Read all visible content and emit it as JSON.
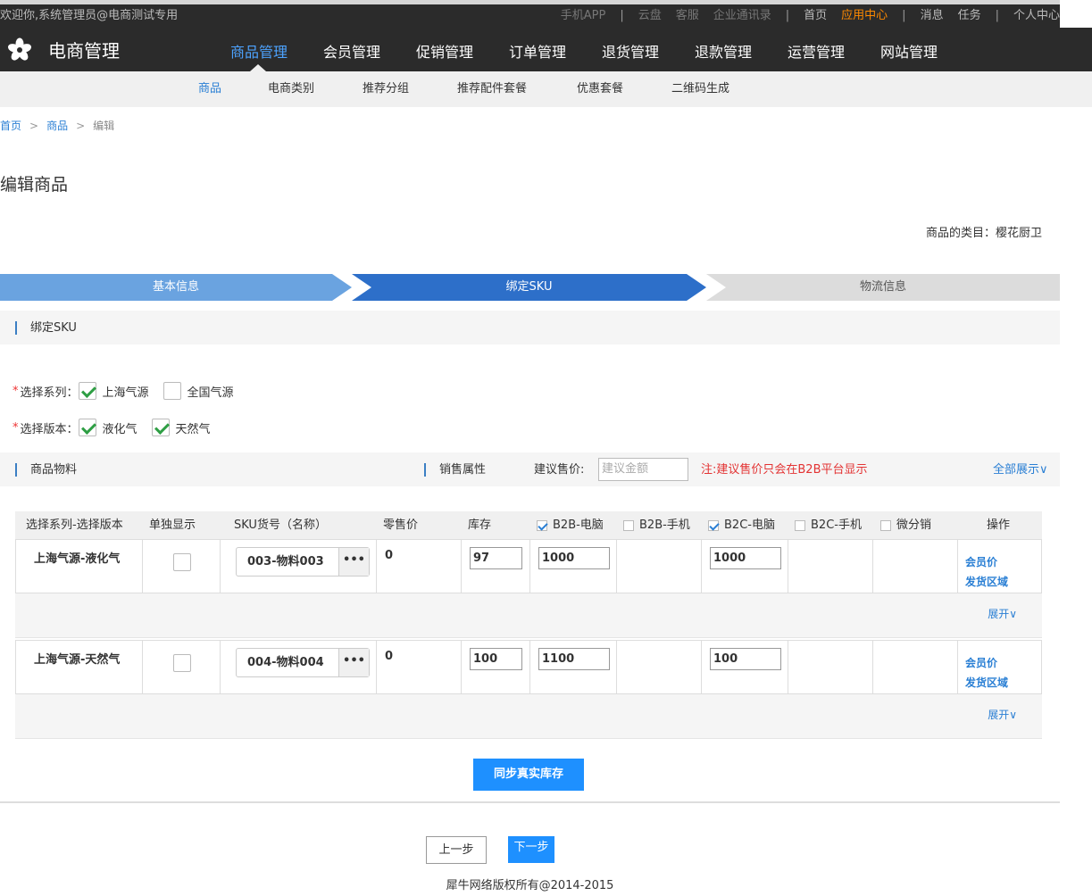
{
  "topbar": {
    "welcome": "欢迎你,系统管理员@电商测试专用",
    "links": {
      "app": "手机APP",
      "cloud": "云盘",
      "service": "客服",
      "contacts": "企业通讯录",
      "home": "首页",
      "appcenter": "应用中心",
      "messages": "消息",
      "tasks": "任务",
      "profile": "个人中心"
    }
  },
  "brand": {
    "title": "电商管理"
  },
  "mainnav": [
    {
      "label": "商品管理",
      "active": true
    },
    {
      "label": "会员管理"
    },
    {
      "label": "促销管理"
    },
    {
      "label": "订单管理"
    },
    {
      "label": "退货管理"
    },
    {
      "label": "退款管理"
    },
    {
      "label": "运营管理"
    },
    {
      "label": "网站管理"
    }
  ],
  "subnav": [
    "商品",
    "电商类别",
    "推荐分组",
    "推荐配件套餐",
    "优惠套餐",
    "二维码生成"
  ],
  "breadcrumb": {
    "home": "首页",
    "product": "商品",
    "current": "编辑"
  },
  "page": {
    "title": "编辑商品",
    "category_label": "商品的类目：",
    "category_value": "樱花厨卫"
  },
  "steps": [
    "基本信息",
    "绑定SKU",
    "物流信息"
  ],
  "section_bind": "绑定SKU",
  "series": {
    "label": "选择系列：",
    "options": [
      {
        "label": "上海气源",
        "checked": true
      },
      {
        "label": "全国气源",
        "checked": false
      }
    ]
  },
  "version": {
    "label": "选择版本：",
    "options": [
      {
        "label": "液化气",
        "checked": true
      },
      {
        "label": "天然气",
        "checked": true
      }
    ]
  },
  "material": {
    "title": "商品物料",
    "sales_attr": "销售属性",
    "suggest_label": "建议售价:",
    "suggest_placeholder": "建议金额",
    "note": "注:建议售价只会在B2B平台显示",
    "show_all": "全部展示∨"
  },
  "table": {
    "headers": {
      "series_version": "选择系列-选择版本",
      "single": "单独显示",
      "sku": "SKU货号（名称）",
      "retail": "零售价",
      "stock": "库存",
      "b2b_pc": "B2B-电脑",
      "b2b_mobile": "B2B-手机",
      "b2c_pc": "B2C-电脑",
      "b2c_mobile": "B2C-手机",
      "wfx": "微分销",
      "ops": "操作"
    },
    "rows": [
      {
        "name": "上海气源-液化气",
        "sku": "003-物料003",
        "price": "0",
        "stock": "97",
        "b2b_pc": "1000",
        "b2c_pc": "1000"
      },
      {
        "name": "上海气源-天然气",
        "sku": "004-物料004",
        "price": "0",
        "stock": "100",
        "b2b_pc": "1100",
        "b2c_pc": "100"
      }
    ],
    "more_glyph": "•••",
    "member_price": "会员价",
    "ship_region": "发货区域",
    "expand": "展开∨"
  },
  "buttons": {
    "sync": "同步真实库存",
    "prev": "上一步",
    "next": "下一步"
  },
  "footer": "犀牛网络版权所有@2014-2015",
  "colors": {
    "topbar_bg": "#2b2b2b",
    "accent": "#1e90ff",
    "link": "#2a7fd4",
    "highlight": "#ff8a00",
    "step_done": "#6aa3e0",
    "step_active": "#2d6fc9",
    "step_todo": "#dcdcdc",
    "note": "#e33333"
  }
}
